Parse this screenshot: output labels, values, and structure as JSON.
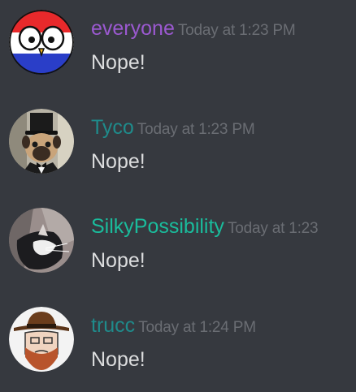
{
  "colors": {
    "background": "#36393f",
    "timestamp": "#6a6d73",
    "message_text": "#dcddde"
  },
  "messages": [
    {
      "author": "everyone",
      "author_color": "#9b59d0",
      "timestamp": "Today at 1:23 PM",
      "content": "Nope!",
      "avatar_icon": "countryball-avatar-icon"
    },
    {
      "author": "Tyco",
      "author_color": "#1f8b8b",
      "timestamp": "Today at 1:23 PM",
      "content": "Nope!",
      "avatar_icon": "pug-top-hat-avatar-icon"
    },
    {
      "author": "SilkyPossibility",
      "author_color": "#1abc9c",
      "timestamp": "Today at 1:23",
      "content": "Nope!",
      "avatar_icon": "cat-photo-avatar-icon"
    },
    {
      "author": "trucc",
      "author_color": "#1f8b8b",
      "timestamp": "Today at 1:24 PM",
      "content": "Nope!",
      "avatar_icon": "cowboy-wojak-avatar-icon"
    }
  ]
}
